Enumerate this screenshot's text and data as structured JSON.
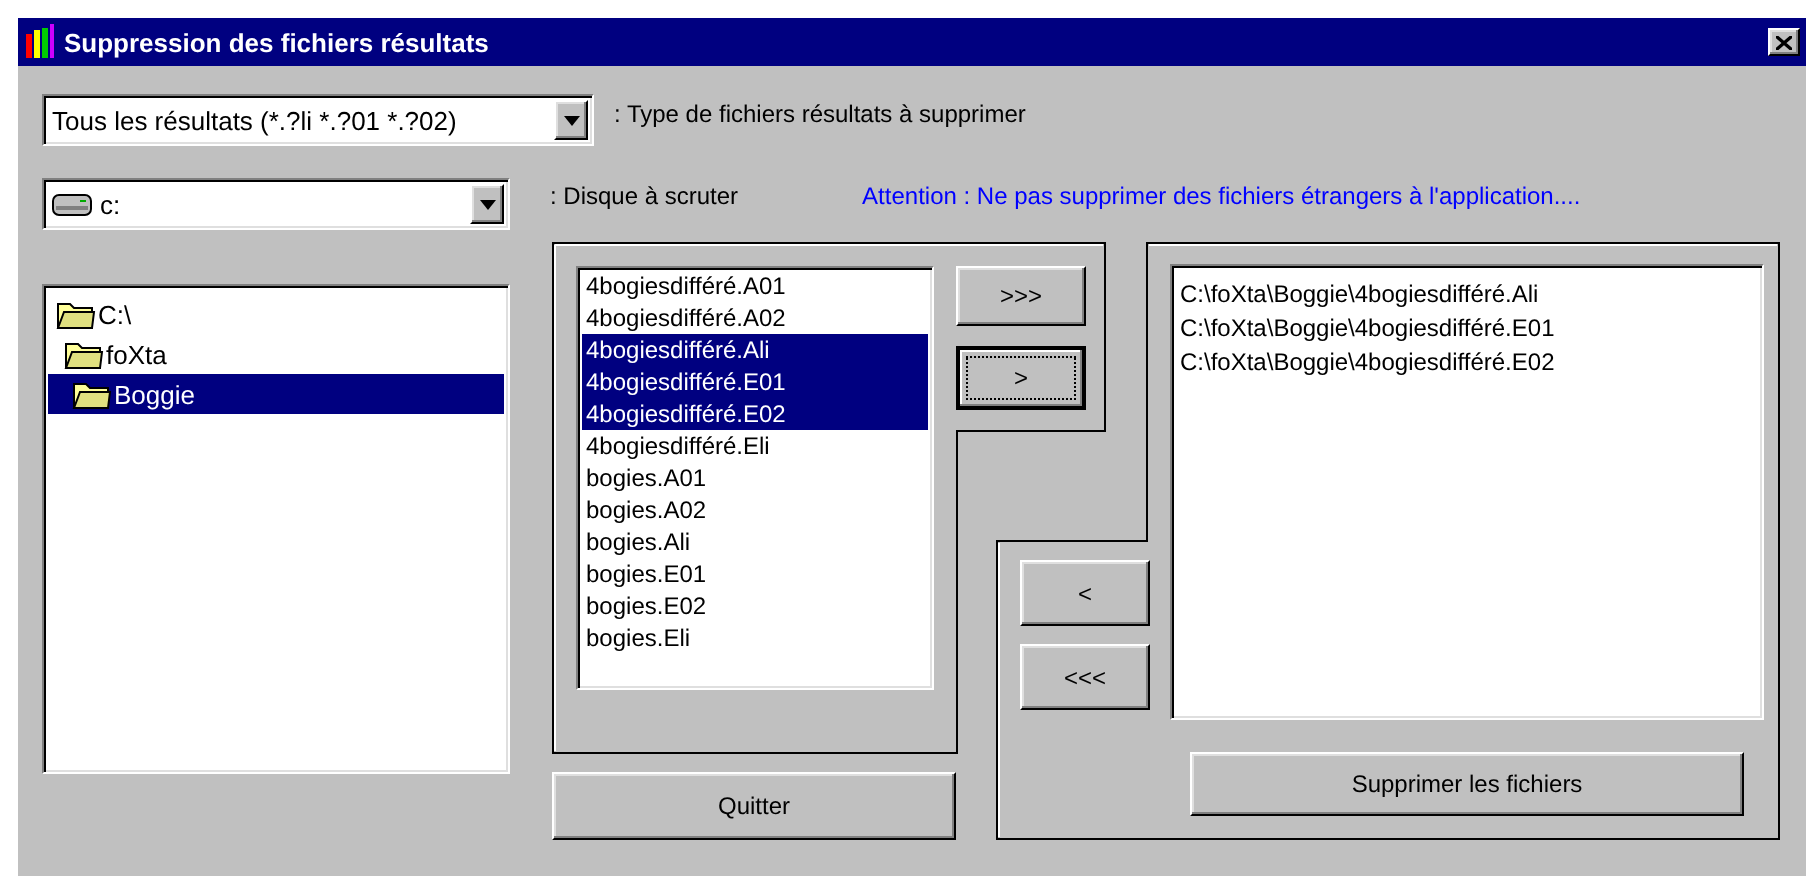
{
  "window": {
    "title": "Suppression des fichiers résultats"
  },
  "file_type": {
    "value": "Tous les résultats (*.?li *.?01 *.?02)",
    "label": ": Type de fichiers résultats à supprimer"
  },
  "drive": {
    "value": "c:",
    "label": ": Disque à scruter"
  },
  "warning": "Attention : Ne pas supprimer des fichiers étrangers à l'application....",
  "folders": [
    {
      "label": "C:\\",
      "selected": false,
      "children": [
        {
          "label": "foXta",
          "selected": false,
          "children": [
            {
              "label": "Boggie",
              "selected": true
            }
          ]
        }
      ]
    }
  ],
  "files": [
    {
      "name": "4bogiesdifféré.A01",
      "selected": false
    },
    {
      "name": "4bogiesdifféré.A02",
      "selected": false
    },
    {
      "name": "4bogiesdifféré.Ali",
      "selected": true
    },
    {
      "name": "4bogiesdifféré.E01",
      "selected": true
    },
    {
      "name": "4bogiesdifféré.E02",
      "selected": true
    },
    {
      "name": "4bogiesdifféré.Eli",
      "selected": false
    },
    {
      "name": "bogies.A01",
      "selected": false
    },
    {
      "name": "bogies.A02",
      "selected": false
    },
    {
      "name": "bogies.Ali",
      "selected": false
    },
    {
      "name": "bogies.E01",
      "selected": false
    },
    {
      "name": "bogies.E02",
      "selected": false
    },
    {
      "name": "bogies.Eli",
      "selected": false
    }
  ],
  "transfer_buttons": [
    {
      "label": ">>>",
      "focused": false
    },
    {
      "label": ">",
      "focused": true
    },
    {
      "label": "<",
      "focused": false
    },
    {
      "label": "<<<",
      "focused": false
    }
  ],
  "files_to_delete": [
    "C:\\foXta\\Boggie\\4bogiesdifféré.Ali",
    "C:\\foXta\\Boggie\\4bogiesdifféré.E01",
    "C:\\foXta\\Boggie\\4bogiesdifféré.E02"
  ],
  "delete_button": "Supprimer les fichiers",
  "quit_button": "Quitter"
}
